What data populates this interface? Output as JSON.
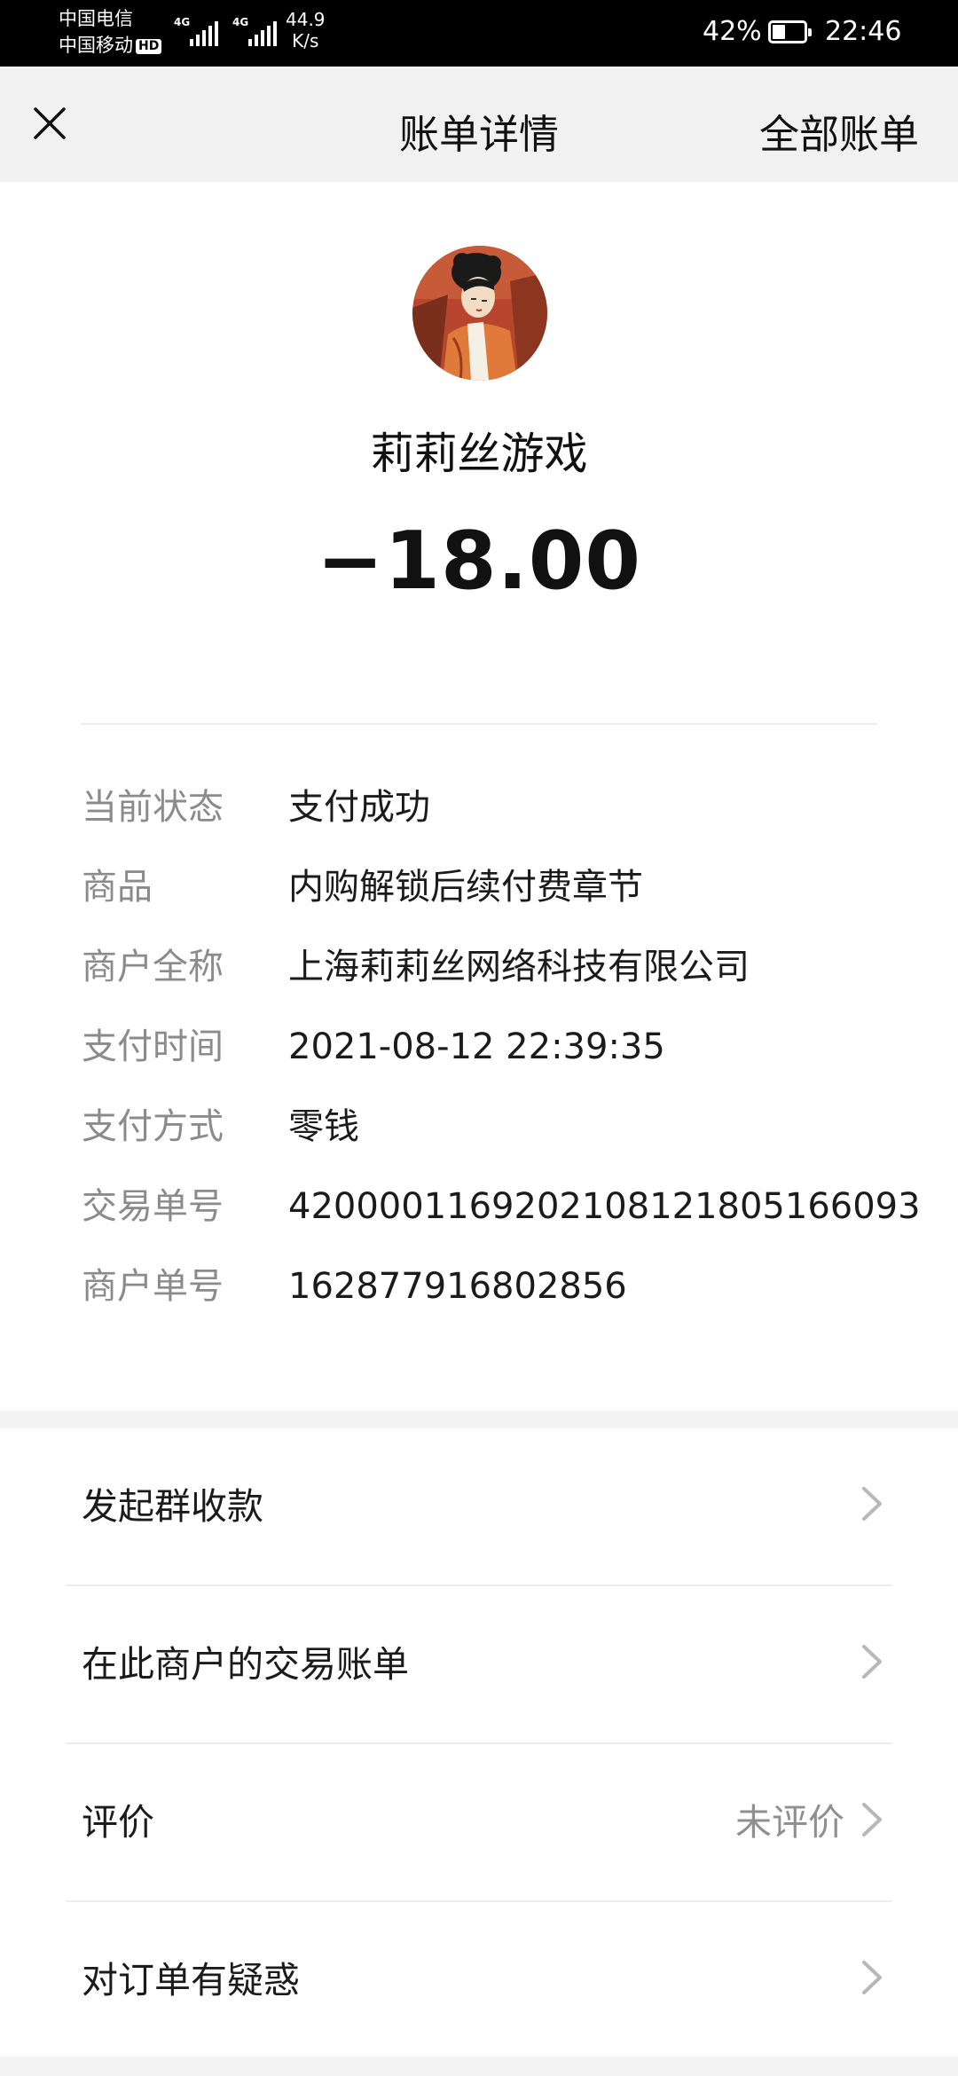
{
  "status_bar": {
    "carrier_1": "中国电信",
    "carrier_2": "中国移动",
    "hd_badge": "HD",
    "network_1": "4G",
    "network_2": "4G",
    "speed_value": "44.9",
    "speed_unit": "K/s",
    "battery_percent": "42%",
    "battery_level": 0.42,
    "time": "22:46"
  },
  "header": {
    "close_icon": "close-icon",
    "title": "账单详情",
    "right_action": "全部账单"
  },
  "merchant": {
    "avatar": "merchant-avatar-illustration",
    "name": "莉莉丝游戏",
    "amount": "−18.00"
  },
  "details": [
    {
      "label": "当前状态",
      "value": "支付成功"
    },
    {
      "label": "商品",
      "value": "内购解锁后续付费章节"
    },
    {
      "label": "商户全称",
      "value": "上海莉莉丝网络科技有限公司"
    },
    {
      "label": "支付时间",
      "value": "2021-08-12 22:39:35"
    },
    {
      "label": "支付方式",
      "value": "零钱"
    },
    {
      "label": "交易单号",
      "value": "4200001169202108121805166093"
    },
    {
      "label": "商户单号",
      "value": "162877916802856"
    }
  ],
  "actions": [
    {
      "label": "发起群收款",
      "extra": ""
    },
    {
      "label": "在此商户的交易账单",
      "extra": ""
    },
    {
      "label": "评价",
      "extra": "未评价"
    },
    {
      "label": "对订单有疑惑",
      "extra": ""
    }
  ],
  "icons": {
    "chevron": "chevron-right-icon"
  },
  "colors": {
    "header_bg": "#f1f1f1",
    "label_gray": "#8b8b8b",
    "text_dark": "#111111",
    "divider": "#ececec"
  }
}
